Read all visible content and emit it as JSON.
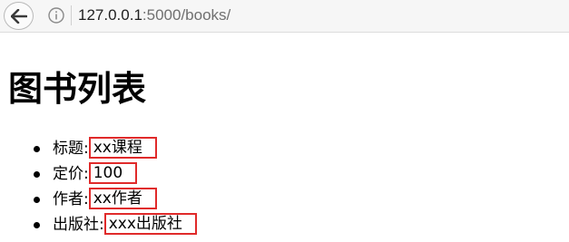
{
  "browser": {
    "url_host": "127.0.0.1",
    "url_rest": ":5000/books/"
  },
  "page": {
    "title": "图书列表"
  },
  "book": {
    "fields": [
      {
        "label": "标题:",
        "value": "xx课程"
      },
      {
        "label": "定价:",
        "value": "100"
      },
      {
        "label": "作者:",
        "value": "xx作者"
      },
      {
        "label": "出版社:",
        "value": "xxx出版社"
      }
    ]
  },
  "colors": {
    "highlight_box": "#e02a2a"
  }
}
